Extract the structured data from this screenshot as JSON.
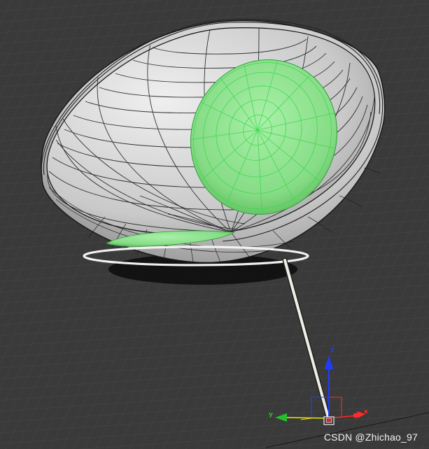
{
  "viewport": {
    "background_color": "#3a3a3a",
    "grid_color": "#4a4a4a"
  },
  "model": {
    "bowl_color": "#d8d8d8",
    "wireframe_color": "#1a1a1a",
    "cushion_color": "#8fe08f",
    "cushion_wire_color": "#3fd84f",
    "stand_color": "#efefe6"
  },
  "gizmo": {
    "axes": [
      {
        "label": "z",
        "color": "#1e3cff"
      },
      {
        "label": "y",
        "color": "#22c02a"
      },
      {
        "label": "x",
        "color": "#ff2a2a"
      }
    ]
  },
  "watermark": {
    "text": "CSDN @Zhichao_97"
  }
}
